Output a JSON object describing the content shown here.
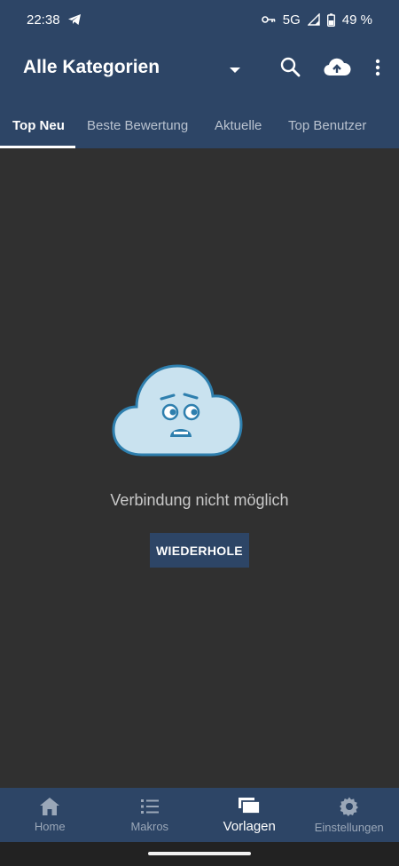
{
  "status_bar": {
    "time": "22:38",
    "network": "5G",
    "battery": "49 %"
  },
  "app_bar": {
    "title": "Alle Kategorien",
    "icons": [
      "dropdown-arrow-icon",
      "search-icon",
      "cloud-upload-icon",
      "more-vert-icon"
    ]
  },
  "tabs": [
    {
      "label": "Top Neu",
      "active": true
    },
    {
      "label": "Beste Bewertung",
      "active": false
    },
    {
      "label": "Aktuelle",
      "active": false
    },
    {
      "label": "Top Benutzer",
      "active": false
    }
  ],
  "empty_state": {
    "message": "Verbindung nicht möglich",
    "retry_label": "WIEDERHOLE"
  },
  "bottom_nav": [
    {
      "label": "Home",
      "icon": "home-icon",
      "active": false
    },
    {
      "label": "Makros",
      "icon": "list-icon",
      "active": false
    },
    {
      "label": "Vorlagen",
      "icon": "templates-icon",
      "active": true
    },
    {
      "label": "Einstellungen",
      "icon": "gear-icon",
      "active": false
    }
  ],
  "colors": {
    "primary": "#2d4566",
    "background": "#303030",
    "cloud_fill": "#c9e2ef",
    "cloud_stroke": "#2e7fae"
  }
}
